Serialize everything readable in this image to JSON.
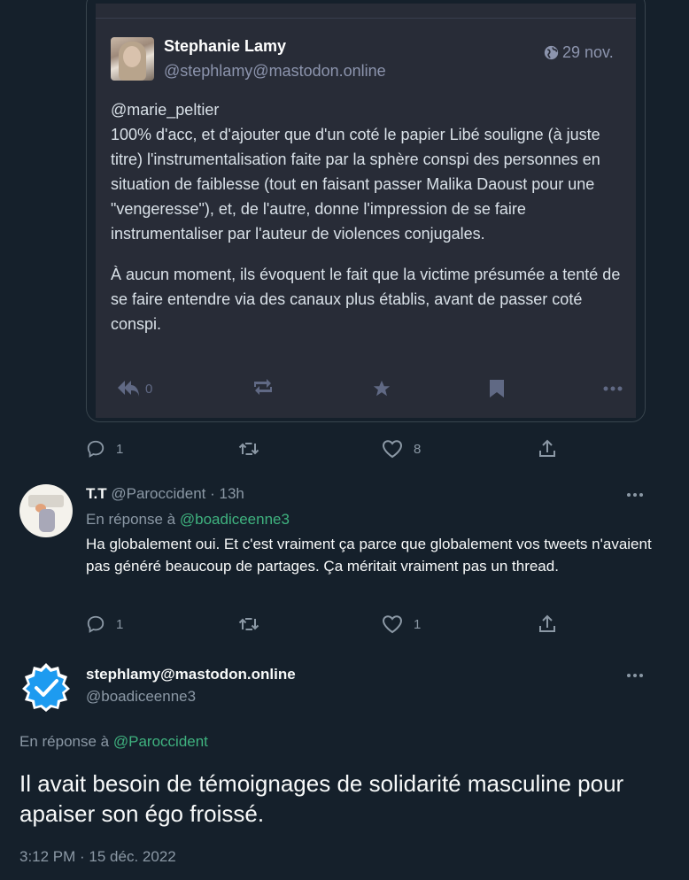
{
  "embed": {
    "author_name": "Stephanie Lamy",
    "author_handle": "@stephlamy@mastodon.online",
    "date": "29 nov.",
    "mention": "@marie_peltier",
    "paragraph1": "100% d'acc, et d'ajouter que d'un coté le papier Libé souligne (à juste titre) l'instrumentalisation faite par la sphère conspi des personnes en situation de faiblesse (tout en faisant passer Malika Daoust pour une \"vengeresse\"), et, de l'autre, donne l'impression de se faire instrumentaliser par l'auteur de violences conjugales.",
    "paragraph2": "À aucun moment, ils évoquent le fait que la victime présumée a tenté de se faire entendre via des canaux plus établis, avant de passer coté conspi.",
    "reply_count": "0"
  },
  "tweet1_actions": {
    "replies": "1",
    "likes": "8"
  },
  "reply_tweet": {
    "name": "T.T",
    "handle": "@Paroccident",
    "time": "· 13h",
    "replying_prefix": "En réponse à",
    "replying_to": "@boadiceenne3",
    "text": "Ha globalement oui. Et c'est vraiment ça parce que globalement vos tweets n'avaient pas généré beaucoup de partages. Ça méritait vraiment pas un thread.",
    "replies": "1",
    "likes": "1"
  },
  "main_tweet": {
    "name": "stephlamy@mastodon.online",
    "handle": "@boadiceenne3",
    "replying_prefix": "En réponse à",
    "replying_to": "@Paroccident",
    "text": "Il avait besoin de témoignages de solidarité masculine pour apaiser son égo froissé.",
    "timestamp": "3:12 PM · 15 déc. 2022"
  },
  "colors": {
    "background": "#15202b",
    "embed_background": "#282c37",
    "accent_blue": "#1d9bf0",
    "mention_green": "#3fb27f",
    "muted": "#8b98a5"
  }
}
